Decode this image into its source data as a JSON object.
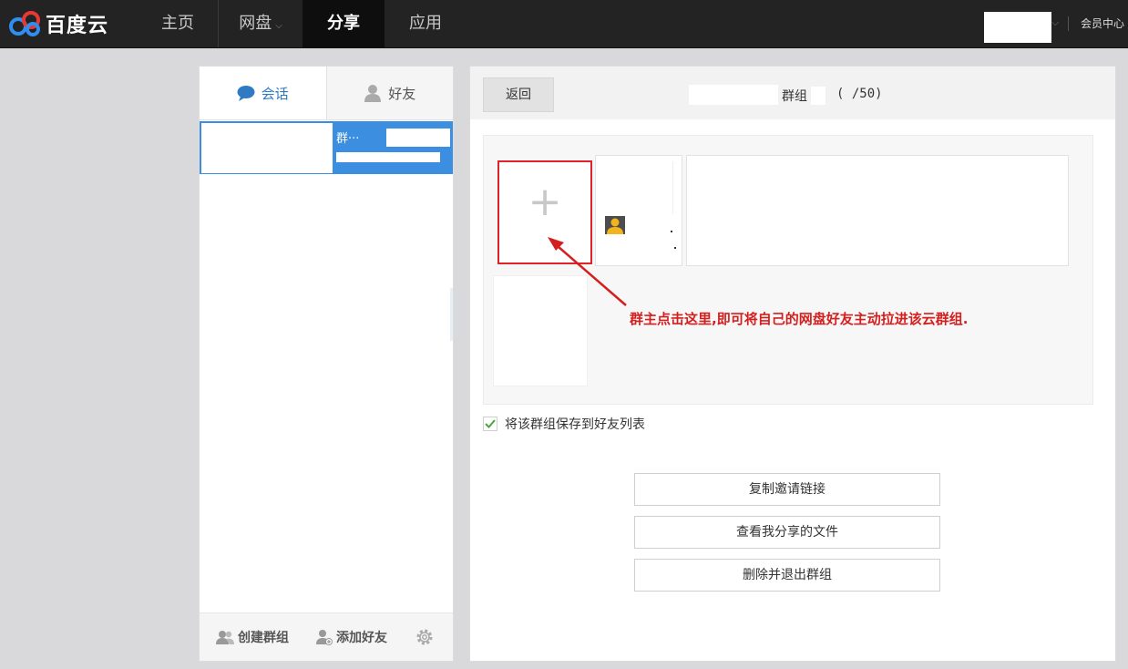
{
  "brand": {
    "name": "百度云"
  },
  "nav": {
    "items": [
      {
        "label": "主页"
      },
      {
        "label": "网盘"
      },
      {
        "label": "分享"
      },
      {
        "label": "应用"
      }
    ],
    "dropdown_caret": "﹀",
    "member_center": "会员中心"
  },
  "left": {
    "tabs": [
      {
        "label": "会话"
      },
      {
        "label": "好友"
      }
    ],
    "conversation": {
      "name": "群···"
    },
    "footer": {
      "create_group": "创建群组",
      "add_friend": "添加好友"
    }
  },
  "right": {
    "back": "返回",
    "title": "群组",
    "member_count": "( /50)",
    "add_member_symbol": "+",
    "annotation": "群主点击这里,即可将自己的网盘好友主动拉进该云群组.",
    "save_to_friends": "将该群组保存到好友列表",
    "save_checked": true,
    "buttons": {
      "copy_invite": "复制邀请链接",
      "view_shared": "查看我分享的文件",
      "delete_exit": "删除并退出群组"
    }
  },
  "colors": {
    "topbar": "#232323",
    "accent_blue": "#3b8ee0",
    "annotation_red": "#d41f1f",
    "check_green": "#4aa63c"
  }
}
